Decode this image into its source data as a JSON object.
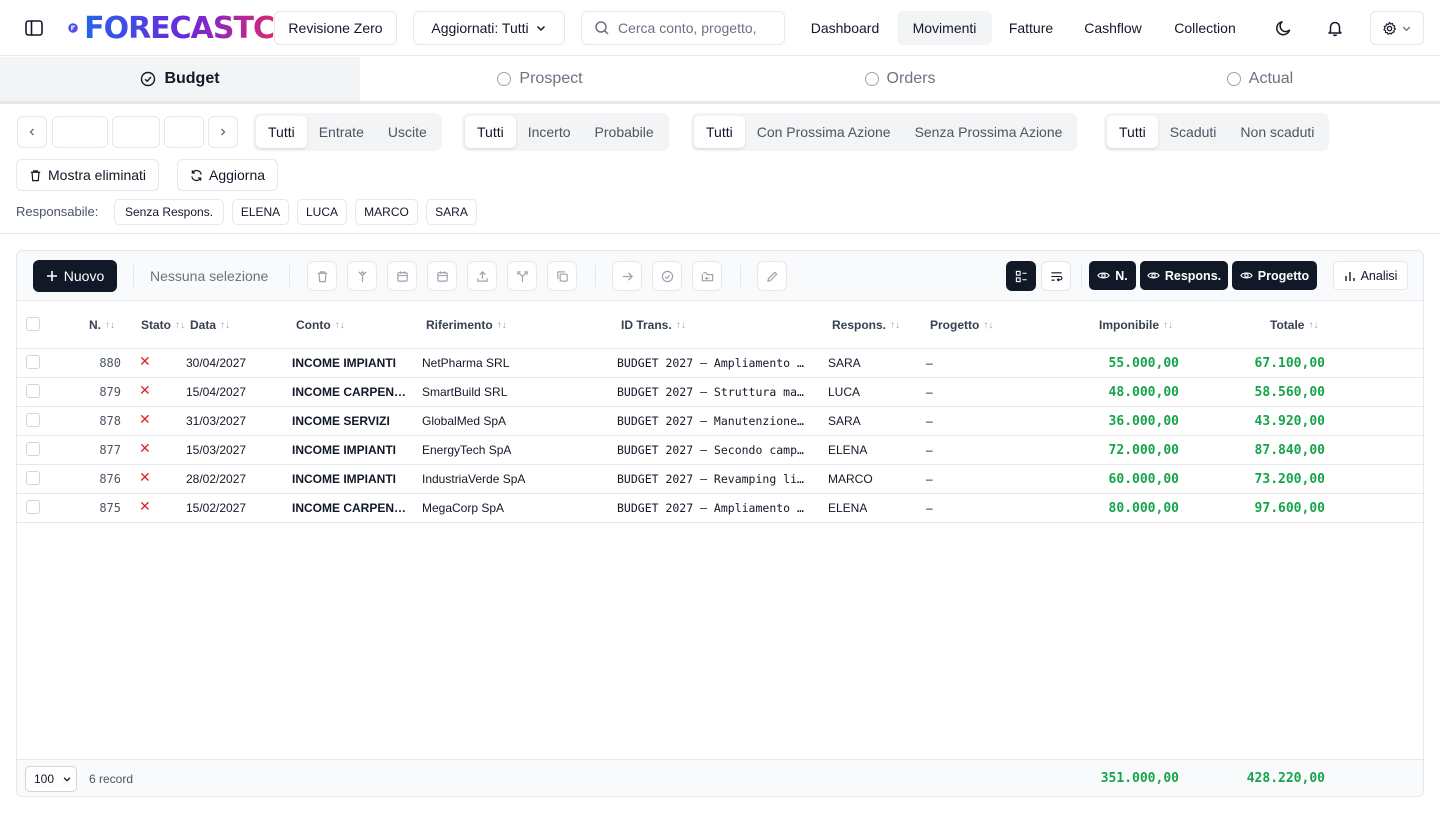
{
  "header": {
    "logo_text": "FORECASTC",
    "revision_label": "Revisione Zero",
    "updated_label": "Aggiornati: Tutti",
    "search_placeholder": "Cerca conto, progetto,",
    "nav": [
      {
        "label": "Dashboard",
        "active": false
      },
      {
        "label": "Movimenti",
        "active": true
      },
      {
        "label": "Fatture",
        "active": false
      },
      {
        "label": "Cashflow",
        "active": false
      },
      {
        "label": "Collection",
        "active": false
      }
    ]
  },
  "stage_tabs": [
    {
      "label": "Budget",
      "active": true
    },
    {
      "label": "Prospect",
      "active": false
    },
    {
      "label": "Orders",
      "active": false
    },
    {
      "label": "Actual",
      "active": false
    }
  ],
  "filters": {
    "direction": [
      "Tutti",
      "Entrate",
      "Uscite"
    ],
    "probability": [
      "Tutti",
      "Incerto",
      "Probabile"
    ],
    "next_action": [
      "Tutti",
      "Con Prossima Azione",
      "Senza Prossima Azione"
    ],
    "due": [
      "Tutti",
      "Scaduti",
      "Non scaduti"
    ],
    "show_deleted_label": "Mostra eliminati",
    "refresh_label": "Aggiorna",
    "responsabile_label": "Responsabile:",
    "responsabili": [
      "Senza Respons.",
      "ELENA",
      "LUCA",
      "MARCO",
      "SARA"
    ]
  },
  "toolbar": {
    "new_label": "Nuovo",
    "selection_label": "Nessuna selezione",
    "toggles": [
      "N.",
      "Respons.",
      "Progetto"
    ],
    "analysis_label": "Analisi"
  },
  "table": {
    "columns": {
      "num": "N.",
      "stato": "Stato",
      "data": "Data",
      "conto": "Conto",
      "riferimento": "Riferimento",
      "id_trans": "ID Trans.",
      "respons": "Respons.",
      "progetto": "Progetto",
      "imponibile": "Imponibile",
      "totale": "Totale"
    },
    "rows": [
      {
        "num": "880",
        "stato": "✕",
        "data": "30/04/2027",
        "conto": "INCOME IMPIANTI",
        "riferimento": "NetPharma SRL",
        "id_trans": "BUDGET 2027 – Ampliamento …",
        "respons": "SARA",
        "progetto": "–",
        "imponibile": "55.000,00",
        "totale": "67.100,00"
      },
      {
        "num": "879",
        "stato": "✕",
        "data": "15/04/2027",
        "conto": "INCOME CARPENT…",
        "riferimento": "SmartBuild SRL",
        "id_trans": "BUDGET 2027 – Struttura ma…",
        "respons": "LUCA",
        "progetto": "–",
        "imponibile": "48.000,00",
        "totale": "58.560,00"
      },
      {
        "num": "878",
        "stato": "✕",
        "data": "31/03/2027",
        "conto": "INCOME SERVIZI",
        "riferimento": "GlobalMed SpA",
        "id_trans": "BUDGET 2027 – Manutenzione…",
        "respons": "SARA",
        "progetto": "–",
        "imponibile": "36.000,00",
        "totale": "43.920,00"
      },
      {
        "num": "877",
        "stato": "✕",
        "data": "15/03/2027",
        "conto": "INCOME IMPIANTI",
        "riferimento": "EnergyTech SpA",
        "id_trans": "BUDGET 2027 – Secondo camp…",
        "respons": "ELENA",
        "progetto": "–",
        "imponibile": "72.000,00",
        "totale": "87.840,00"
      },
      {
        "num": "876",
        "stato": "✕",
        "data": "28/02/2027",
        "conto": "INCOME IMPIANTI",
        "riferimento": "IndustriaVerde SpA",
        "id_trans": "BUDGET 2027 – Revamping li…",
        "respons": "MARCO",
        "progetto": "–",
        "imponibile": "60.000,00",
        "totale": "73.200,00"
      },
      {
        "num": "875",
        "stato": "✕",
        "data": "15/02/2027",
        "conto": "INCOME CARPENT…",
        "riferimento": "MegaCorp SpA",
        "id_trans": "BUDGET 2027 – Ampliamento …",
        "respons": "ELENA",
        "progetto": "–",
        "imponibile": "80.000,00",
        "totale": "97.600,00"
      }
    ]
  },
  "footer": {
    "page_size": "100",
    "record_count": "6 record",
    "total_imponibile": "351.000,00",
    "total_totale": "428.220,00"
  },
  "colors": {
    "accent_dark": "#111827",
    "positive": "#16a34a",
    "negative": "#dc2626"
  }
}
